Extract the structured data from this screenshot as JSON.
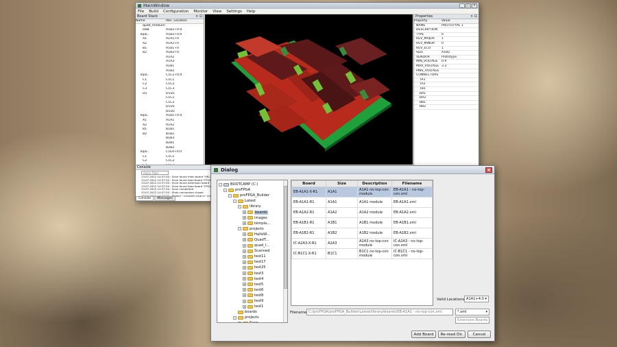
{
  "main_window": {
    "title": "MainWindow",
    "menu": [
      "File",
      "Build",
      "Configuration",
      "Monitor",
      "View",
      "Settings",
      "Help"
    ],
    "board_panel": {
      "header": "Board Stack",
      "columns": [
        "Name",
        "Abs. Location"
      ],
      "rows": [
        [
          "quad_medium",
          ""
        ],
        [
          "HB8",
          "A1B2+0:0"
        ],
        [
          "Topo..",
          "A1B2+0:0"
        ],
        [
          "A1",
          "A1A1+0"
        ],
        [
          "A2",
          "A1A2+0"
        ],
        [
          "B1",
          "A1B1+0"
        ],
        [
          "B2",
          "A1B2+0"
        ],
        [
          "",
          "A1A2"
        ],
        [
          "",
          "A1A3"
        ],
        [
          "",
          "A1B1"
        ],
        [
          "",
          "A1B2"
        ],
        [
          "Topo..",
          "C1C2+0:0"
        ],
        [
          "C1",
          "C1C1"
        ],
        [
          "C2",
          "C1C2"
        ],
        [
          "C3",
          "C1C3"
        ],
        [
          "D1",
          "D1D1"
        ],
        [
          "",
          "C1C1"
        ],
        [
          "",
          "C1C2"
        ],
        [
          "",
          "D1D1"
        ],
        [
          "",
          "D1D2"
        ],
        [
          "Topo..",
          "A1B1+0:0"
        ],
        [
          "A1",
          "A1A1"
        ],
        [
          "A2",
          "A1A2"
        ],
        [
          "B1",
          "B1B1"
        ],
        [
          "B2",
          "B1B2"
        ],
        [
          "",
          "B1B3"
        ],
        [
          "",
          "B2B1"
        ],
        [
          "",
          "B2B2"
        ],
        [
          "Topo..",
          "C1E4+0:0"
        ],
        [
          "C1",
          "C1C1"
        ],
        [
          "C2",
          "C1C2"
        ],
        [
          "C3",
          "C1C3"
        ],
        [
          "E1",
          "E1E1"
        ],
        [
          "",
          "E1E2"
        ],
        [
          "",
          "E1E3"
        ],
        [
          "",
          "E1E4"
        ]
      ]
    },
    "properties_panel": {
      "header": "Properties",
      "columns": [
        "Property",
        "Value"
      ],
      "rows": [
        [
          "NAME",
          "PROTOTYPE 1"
        ],
        [
          "DESCRIPTION",
          ""
        ],
        [
          "TYPE",
          "6"
        ],
        [
          "REV_MAJOR",
          "1"
        ],
        [
          "REV_MINOR",
          "0"
        ],
        [
          "REV_ECO",
          "1"
        ],
        [
          "SIZE",
          "A1B2"
        ],
        [
          "VENDOR",
          "Prototype"
        ],
        [
          "MIN_VOLTAGE",
          "0.9"
        ],
        [
          "MAX_VOLTAGE",
          "3.3"
        ],
        [
          "PINS_VOLTAGE",
          ""
        ],
        [
          "CONNECTORS",
          ""
        ],
        [
          "TA1",
          ""
        ],
        [
          "TA2",
          ""
        ],
        [
          "TB1",
          ""
        ],
        [
          "BA1",
          ""
        ],
        [
          "BA2",
          ""
        ],
        [
          "BB1",
          ""
        ],
        [
          "BB2",
          ""
        ]
      ]
    },
    "console": {
      "header": "Console",
      "search_placeholder": "Apply Filter",
      "lines": [
        "13.07.2012 14:37:20 : Scan found main board \"HB-2P-072\"",
        "13.07.2012 14:37:20 : Scan found topo board \"FPGA-TT\"",
        "13.07.2012 14:37:20 : Scan found extension board \"EB-FPF\"",
        "13.07.2012 14:37:20 : Scan found topo board \"FPGA-TT\"",
        "13.07.2012 14:37:20 : Scan completed",
        "13.07.2012 14:37:20 : Slots connection closed",
        "13.07.2012 14:37:20 : Project \"<System-Scan>\" created"
      ],
      "tabs": [
        "Console",
        "Messages"
      ]
    }
  },
  "dialog": {
    "title": "Dialog",
    "tree": [
      {
        "label": "BOOTCAMP (C:)",
        "depth": 0,
        "exp": "-"
      },
      {
        "label": "proFPGA",
        "depth": 1,
        "exp": "-"
      },
      {
        "label": "proFPGA_Builder",
        "depth": 2,
        "exp": "-"
      },
      {
        "label": "Latest",
        "depth": 3,
        "exp": "-"
      },
      {
        "label": "library",
        "depth": 4,
        "exp": "-"
      },
      {
        "label": "boards",
        "depth": 5,
        "exp": "+",
        "selected": true
      },
      {
        "label": "images",
        "depth": 5,
        "exp": "+"
      },
      {
        "label": "templa...",
        "depth": 5,
        "exp": "+"
      },
      {
        "label": "projects",
        "depth": 4,
        "exp": "-"
      },
      {
        "label": "HalloW...",
        "depth": 5,
        "exp": "+"
      },
      {
        "label": "QuadT...",
        "depth": 5,
        "exp": "+"
      },
      {
        "label": "quad_l...",
        "depth": 5,
        "exp": "+"
      },
      {
        "label": "Scanned",
        "depth": 5,
        "exp": "+"
      },
      {
        "label": "test11",
        "depth": 5,
        "exp": "+"
      },
      {
        "label": "test17",
        "depth": 5,
        "exp": "+"
      },
      {
        "label": "test25",
        "depth": 5,
        "exp": "+"
      },
      {
        "label": "test3",
        "depth": 5,
        "exp": "+"
      },
      {
        "label": "test4",
        "depth": 5,
        "exp": "+"
      },
      {
        "label": "test5",
        "depth": 5,
        "exp": "+"
      },
      {
        "label": "test6",
        "depth": 5,
        "exp": "+"
      },
      {
        "label": "test8",
        "depth": 5,
        "exp": "+"
      },
      {
        "label": "test9",
        "depth": 5,
        "exp": "+"
      },
      {
        "label": "test1",
        "depth": 5,
        "exp": "+"
      },
      {
        "label": "boards",
        "depth": 3,
        "exp": ""
      },
      {
        "label": "projects",
        "depth": 3,
        "exp": "-"
      },
      {
        "label": "Scan",
        "depth": 4,
        "exp": "+"
      },
      {
        "label": "test",
        "depth": 4,
        "exp": "+"
      }
    ],
    "table": {
      "headers": [
        "Board",
        "Size",
        "Description",
        "Filename"
      ],
      "rows": [
        [
          "EB-A1A1-X-R1",
          "A1A1",
          "A1A1 no-top-con module",
          "EB-A1A1 - no-top-con.xml"
        ],
        [
          "EB-A1A1-R1",
          "A1A1",
          "A1A1 module",
          "EB-A1A1.xml"
        ],
        [
          "EB-A1A2-R1",
          "A1A2",
          "A1A2 module",
          "EB-A1A2.xml"
        ],
        [
          "EB-A1B1-R1",
          "A1B1",
          "A1B1 module",
          "EB-A1B1.xml"
        ],
        [
          "EB-A1B2-R1",
          "A1B2",
          "A1B2 module",
          "EB-A1B2.xml"
        ],
        [
          "IC-A2A3-X-R1",
          "A2A3",
          "A2A3 no-top-con module",
          "IC-A2A3 - no-top-con.xml"
        ],
        [
          "IC-B1C1-X-R1",
          "B1C1",
          "B1C1 no-top-con module",
          "IC-B1C1 - no-top-con.xml"
        ]
      ]
    },
    "valid_locations_label": "Valid Locations:",
    "valid_locations_value": "A1A1+4:0",
    "filename_label": "Filename:",
    "filename_value": "C:/proFPGA/proFPGA_Builder/Latest/library/boards/EB-A1A1 - no-top-con.xml",
    "filter_value": "*.xml",
    "filter_type": "Extension Boards",
    "buttons": {
      "add": "Add Board",
      "reread": "Re-read Dir.",
      "cancel": "Cancel"
    }
  },
  "colors": {
    "pcb_red": "#b82a1c",
    "pcb_green": "#1fa03b",
    "pcb_board": "#6a2020",
    "chip_green": "#73c13b",
    "viewport_bg": "#000000"
  }
}
